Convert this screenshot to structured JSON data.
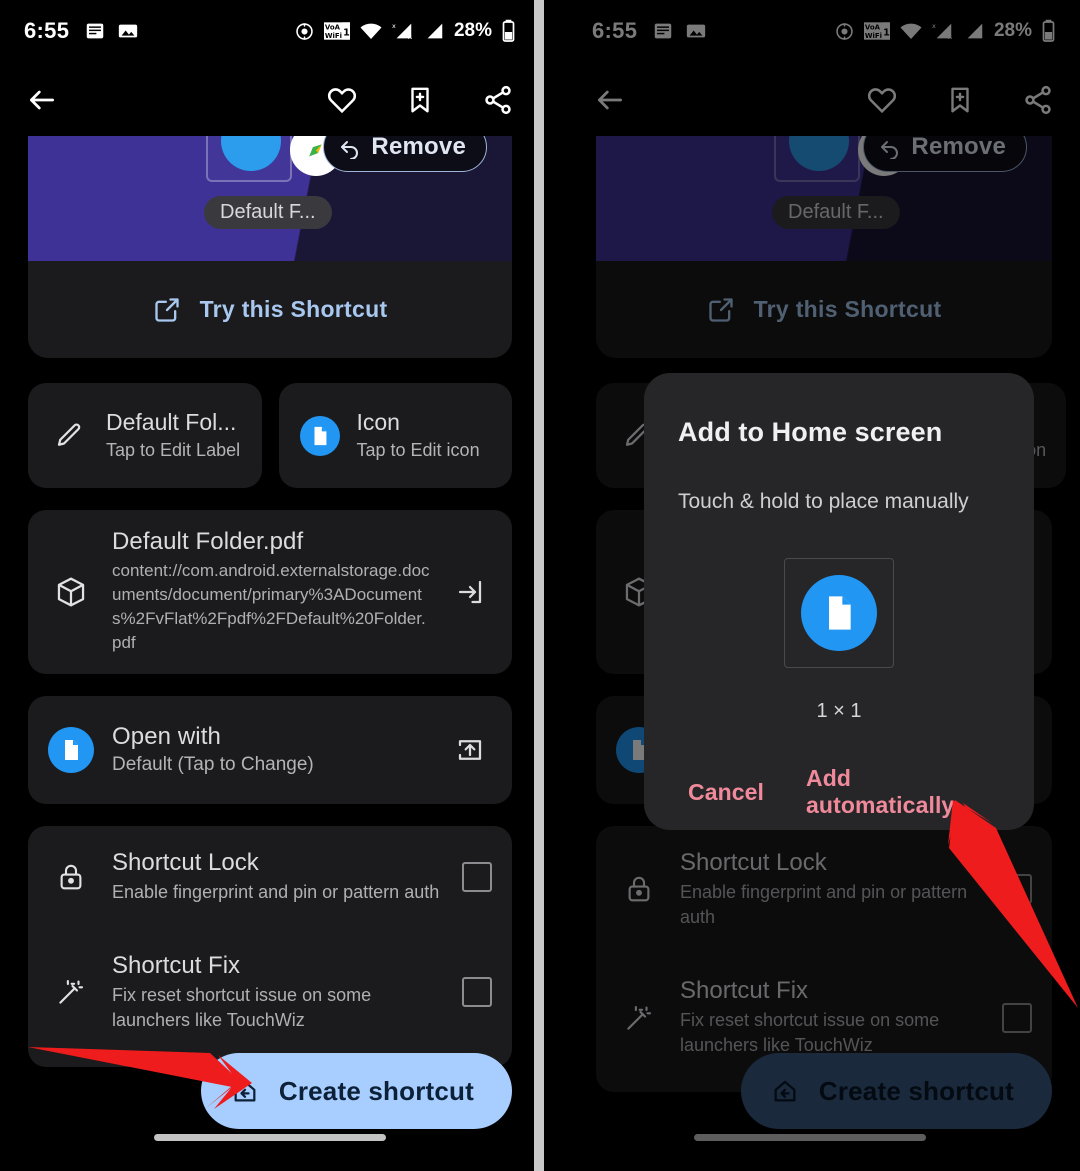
{
  "statusbar": {
    "time": "6:55",
    "battery": "28%",
    "icons": [
      "notes-icon",
      "image-icon",
      "location-icon",
      "vowifi-icon",
      "wifi-icon",
      "signal-1-icon",
      "signal-2-icon",
      "battery-icon"
    ],
    "vowifi_label": "VoWiFi 1"
  },
  "toolbar": {
    "back": "back-arrow-icon",
    "favorite": "heart-icon",
    "bookmark": "bookmark-add-icon",
    "share": "share-icon"
  },
  "hero": {
    "label_chip": "Default F...",
    "remove_label": "Remove",
    "colors": {
      "wedge_light": "#3F3296",
      "wedge_dark": "#191636"
    }
  },
  "try_shortcut": {
    "label": "Try this Shortcut",
    "icon": "open-in-new-icon",
    "color": "#A8C8F0"
  },
  "cards": [
    {
      "title": "Default Fol...",
      "subtitle": "Tap to Edit Label",
      "icon": "pencil-icon"
    },
    {
      "title": "Icon",
      "subtitle": "Tap to Edit icon",
      "icon": "file-icon"
    }
  ],
  "file_card": {
    "title": "Default Folder.pdf",
    "uri": "content://com.android.externalstorage.documents/document/primary%3ADocuments%2FvFlat%2Fpdf%2FDefault%20Folder.pdf",
    "icon": "package-icon",
    "action_icon": "input-arrow-icon"
  },
  "open_with": {
    "title": "Open with",
    "subtitle": "Default (Tap to Change)",
    "icon": "file-icon",
    "action_icon": "open-in-app-icon"
  },
  "toggles": [
    {
      "title": "Shortcut Lock",
      "subtitle": "Enable fingerprint and pin or pattern auth",
      "icon": "lock-icon",
      "checked": false
    },
    {
      "title": "Shortcut Fix",
      "subtitle": "Fix reset shortcut issue on some launchers like TouchWiz",
      "icon": "magic-wand-icon",
      "checked": false
    }
  ],
  "cta": {
    "label": "Create shortcut",
    "icon": "add-to-home-icon",
    "color": "#A8CEFF",
    "dimmed_color": "#37577D"
  },
  "dialog": {
    "title": "Add to Home screen",
    "subtitle": "Touch & hold to place manually",
    "preview_icon": "file-icon",
    "size_label": "1 × 1",
    "cancel_label": "Cancel",
    "confirm_label": "Add automatically",
    "button_color": "#F08A9B"
  },
  "annotations": {
    "arrow_color": "#EE1C1C",
    "left_arrow": "points-to-create-shortcut-button",
    "right_arrow": "points-to-add-automatically-button"
  }
}
